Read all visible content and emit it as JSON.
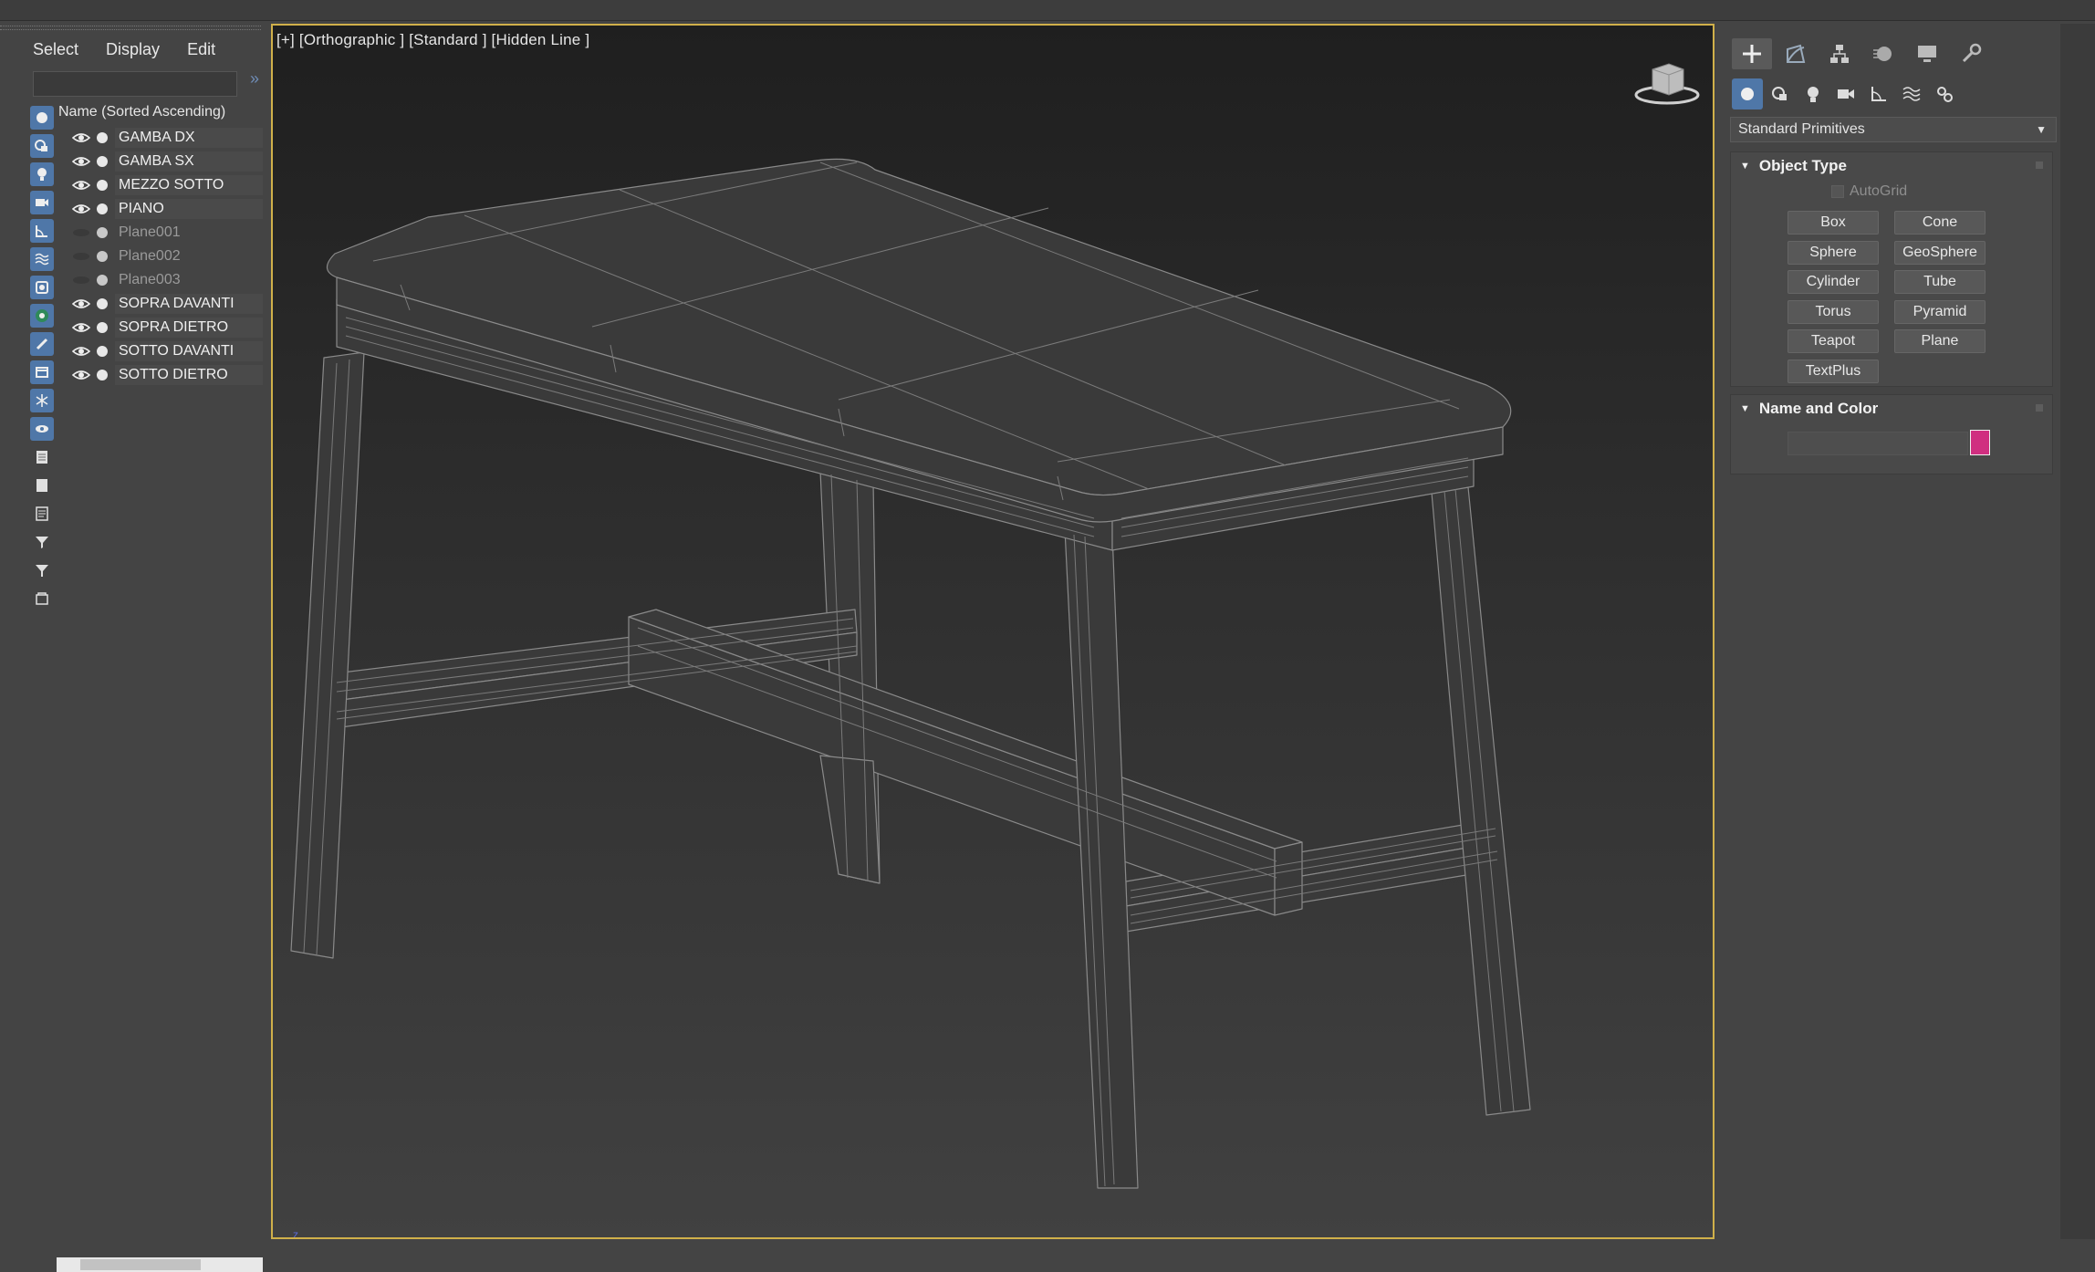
{
  "explorer": {
    "menu": [
      "Select",
      "Display",
      "Edit"
    ],
    "expand_glyph": "»",
    "column_header": "Name (Sorted Ascending)",
    "objects": [
      {
        "name": "GAMBA DX",
        "visible": true
      },
      {
        "name": "GAMBA SX",
        "visible": true
      },
      {
        "name": "MEZZO SOTTO",
        "visible": true
      },
      {
        "name": "PIANO",
        "visible": true
      },
      {
        "name": "Plane001",
        "visible": false
      },
      {
        "name": "Plane002",
        "visible": false
      },
      {
        "name": "Plane003",
        "visible": false
      },
      {
        "name": "SOPRA DAVANTI",
        "visible": true
      },
      {
        "name": "SOPRA DIETRO",
        "visible": true
      },
      {
        "name": "SOTTO DAVANTI",
        "visible": true
      },
      {
        "name": "SOTTO DIETRO",
        "visible": true
      }
    ],
    "tool_icons": [
      "geometry-filter-icon",
      "shapes-filter-icon",
      "lights-filter-icon",
      "cameras-filter-icon",
      "helpers-filter-icon",
      "spacewarps-filter-icon",
      "groups-filter-icon",
      "xrefs-filter-icon",
      "bones-filter-icon",
      "containers-filter-icon",
      "frozen-filter-icon",
      "hidden-filter-icon",
      "select-all-icon",
      "select-none-icon",
      "select-invert-icon",
      "filter-selection-icon",
      "filter-icon",
      "layers-icon"
    ]
  },
  "viewport": {
    "label": "[+] [Orthographic ] [Standard ] [Hidden Line ]",
    "axis_label": "z",
    "border_color": "#d0b04a"
  },
  "command_panel": {
    "tabs": [
      "create-tab",
      "modify-tab",
      "hierarchy-tab",
      "motion-tab",
      "display-tab",
      "utilities-tab"
    ],
    "subtabs": [
      "geometry",
      "shapes",
      "lights",
      "cameras",
      "helpers",
      "spacewarps",
      "systems"
    ],
    "category": "Standard Primitives",
    "object_type": {
      "title": "Object Type",
      "autogrid": "AutoGrid",
      "buttons": [
        "Box",
        "Cone",
        "Sphere",
        "GeoSphere",
        "Cylinder",
        "Tube",
        "Torus",
        "Pyramid",
        "Teapot",
        "Plane",
        "TextPlus"
      ]
    },
    "name_and_color": {
      "title": "Name and Color",
      "name_value": "",
      "color": "#d02f80"
    }
  }
}
